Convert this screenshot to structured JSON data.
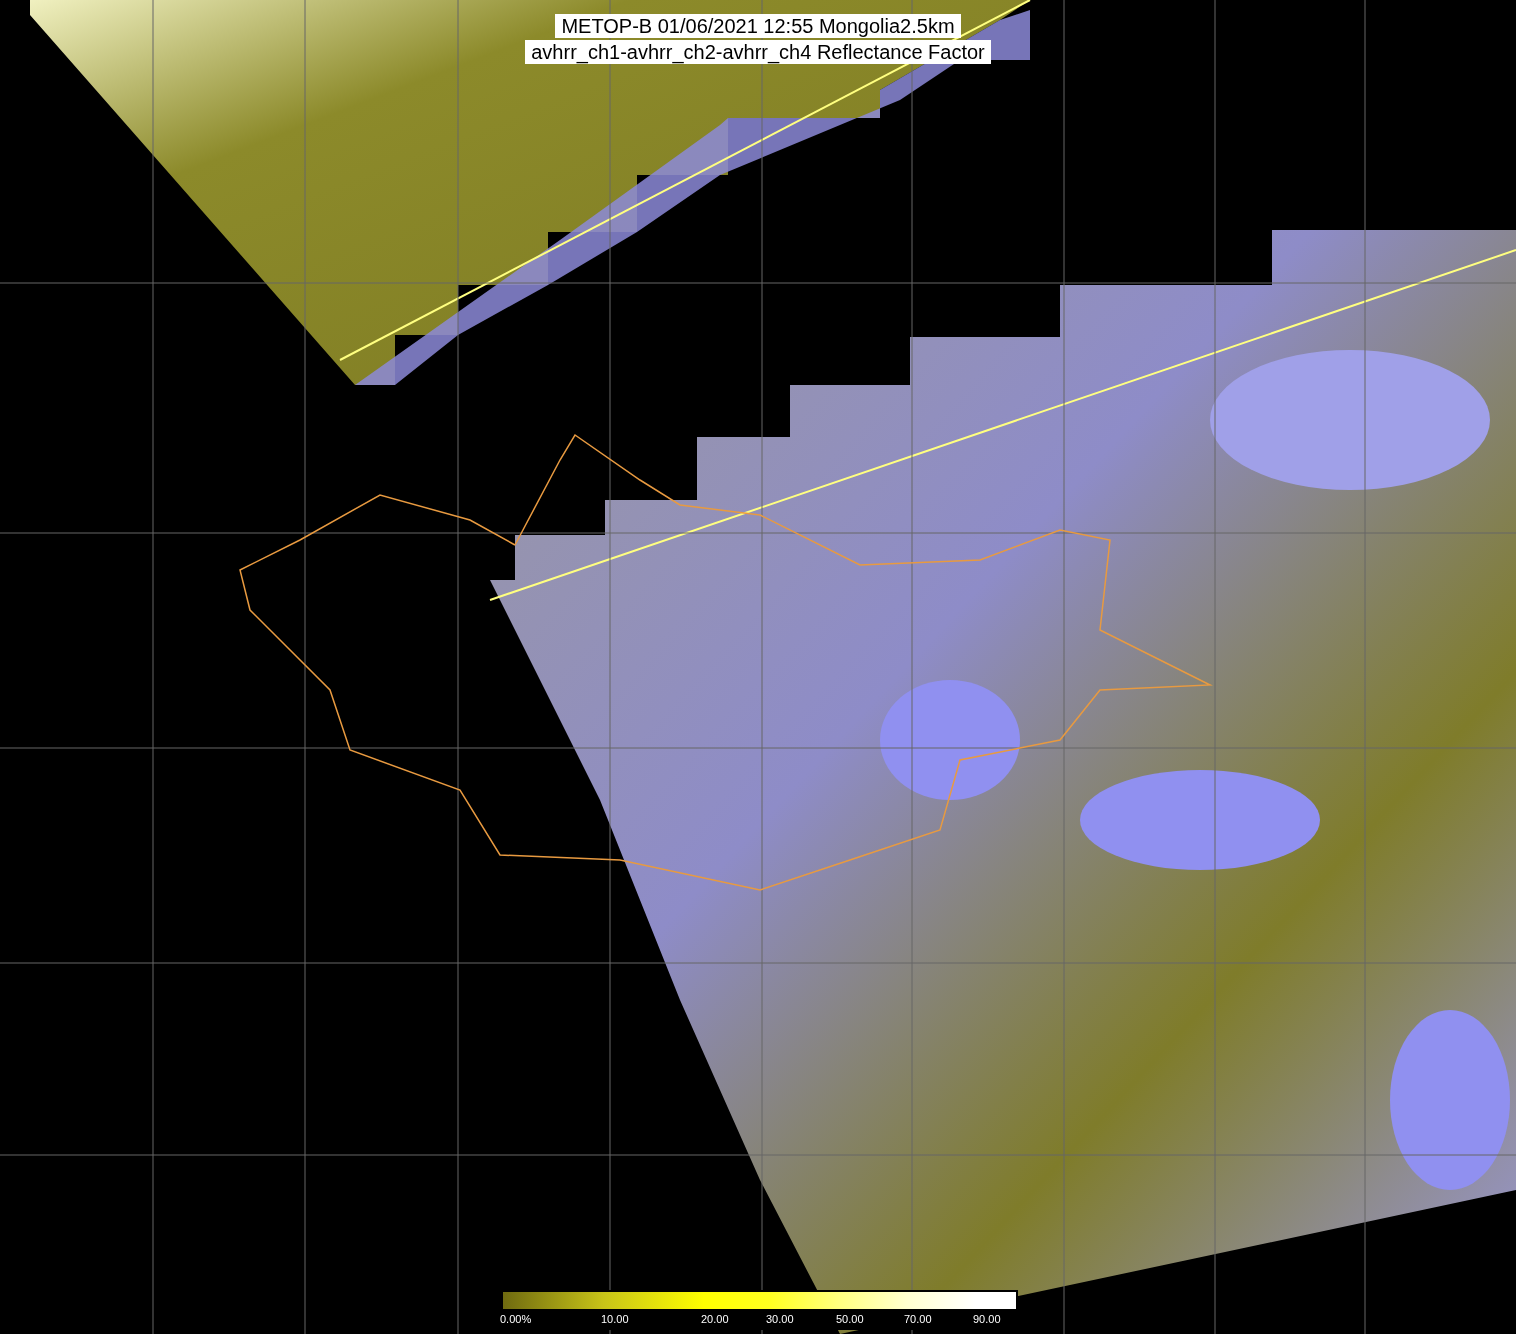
{
  "title": {
    "lines": [
      "METOP-B 01/06/2021 12:55 Mongolia2.5km",
      "avhrr_ch1-avhrr_ch2-avhrr_ch4 Reflectance Factor"
    ]
  },
  "colorbar": {
    "labels": [
      "0.00%",
      "10.00",
      "20.00",
      "30.00",
      "50.00",
      "70.00",
      "90.00"
    ]
  }
}
